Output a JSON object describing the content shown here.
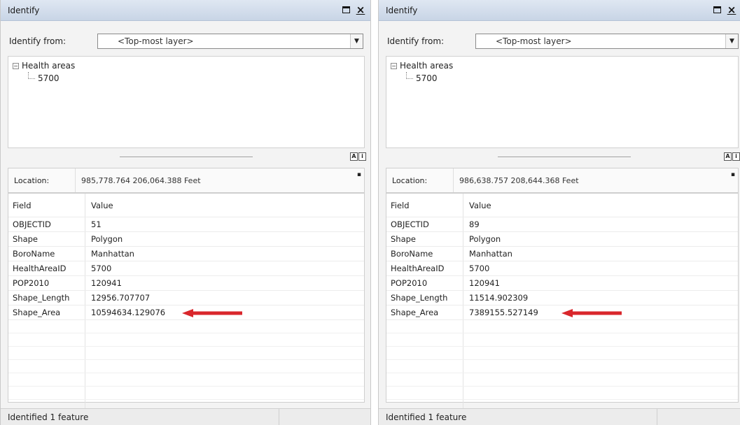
{
  "panels": [
    {
      "title": "Identify",
      "identify_from_label": "Identify from:",
      "identify_from_value": "<Top-most layer>",
      "tree": {
        "layer": "Health areas",
        "feature": "5700"
      },
      "location_label": "Location:",
      "location_value": "985,778.764  206,064.388 Feet",
      "columns": {
        "field": "Field",
        "value": "Value"
      },
      "rows": [
        {
          "field": "OBJECTID",
          "value": "51"
        },
        {
          "field": "Shape",
          "value": "Polygon"
        },
        {
          "field": "BoroName",
          "value": "Manhattan"
        },
        {
          "field": "HealthAreaID",
          "value": "5700"
        },
        {
          "field": "POP2010",
          "value": "120941"
        },
        {
          "field": "Shape_Length",
          "value": "12956.707707"
        },
        {
          "field": "Shape_Area",
          "value": "10594634.129076"
        }
      ],
      "status": "Identified 1 feature",
      "highlight_row": "Shape_Area"
    },
    {
      "title": "Identify",
      "identify_from_label": "Identify from:",
      "identify_from_value": "<Top-most layer>",
      "tree": {
        "layer": "Health areas",
        "feature": "5700"
      },
      "location_label": "Location:",
      "location_value": "986,638.757  208,644.368 Feet",
      "columns": {
        "field": "Field",
        "value": "Value"
      },
      "rows": [
        {
          "field": "OBJECTID",
          "value": "89"
        },
        {
          "field": "Shape",
          "value": "Polygon"
        },
        {
          "field": "BoroName",
          "value": "Manhattan"
        },
        {
          "field": "HealthAreaID",
          "value": "5700"
        },
        {
          "field": "POP2010",
          "value": "120941"
        },
        {
          "field": "Shape_Length",
          "value": "11514.902309"
        },
        {
          "field": "Shape_Area",
          "value": "7389155.527149"
        }
      ],
      "status": "Identified 1 feature",
      "highlight_row": "Shape_Area"
    }
  ],
  "colors": {
    "arrow": "#d9262b",
    "titlebar": "#cfdbea"
  },
  "icons": {
    "maximize": "maximize-icon",
    "close": "close-icon",
    "dropdown": "chevron-down-icon",
    "tree": "tree-collapse-icon"
  }
}
